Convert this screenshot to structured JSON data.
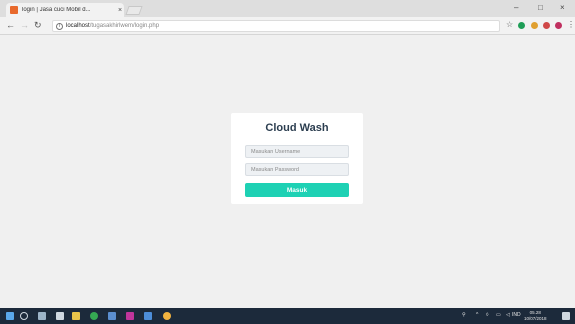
{
  "browser": {
    "tab_title": "login | Jasa cuci Mobil d...",
    "tab_close": "×",
    "url_host": "localhost",
    "url_path": "/tugasakhirlwem/login.php",
    "window_controls": [
      "–",
      "□",
      "×"
    ]
  },
  "login": {
    "title": "Cloud Wash",
    "username_placeholder": "Masukan Username",
    "password_placeholder": "Masukan Password",
    "submit_label": "Masuk"
  },
  "taskbar": {
    "tray_lang": "IND",
    "time": "05.28",
    "date": "10/07/2018"
  },
  "colors": {
    "accent": "#1ed1b4",
    "title": "#2c3e50",
    "taskbar": "#1c2a3b",
    "page_bg": "#f0f0f0"
  }
}
